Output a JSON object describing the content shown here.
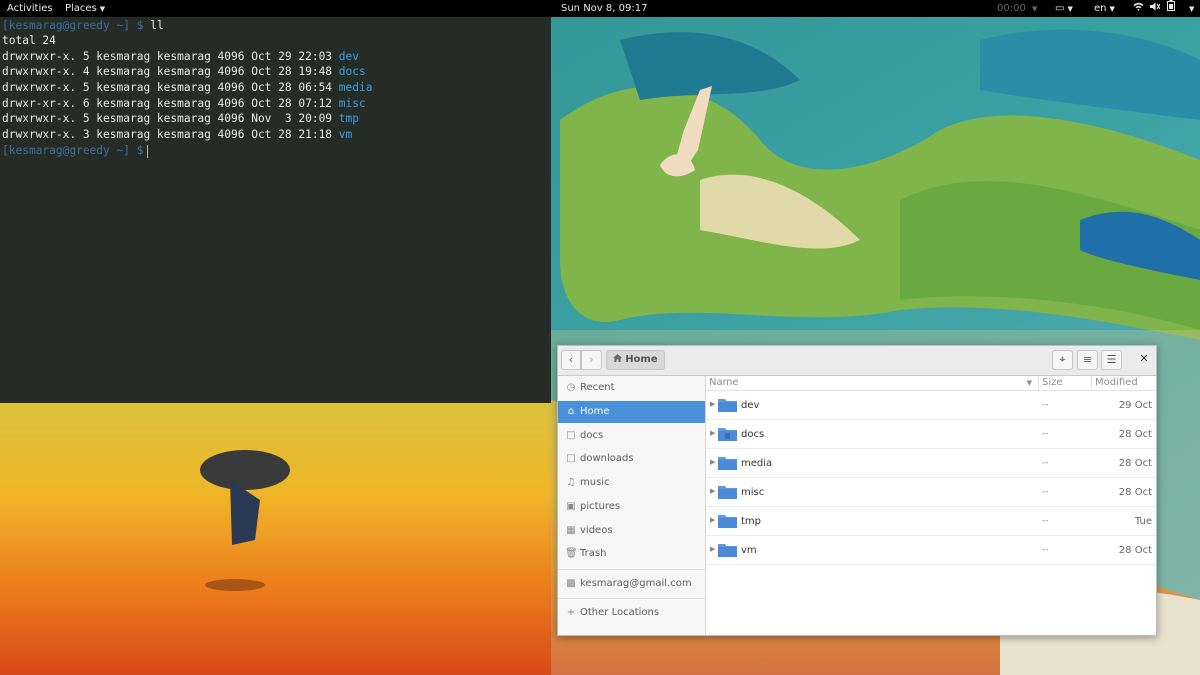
{
  "topbar": {
    "activities": "Activities",
    "places": "Places",
    "clock": "Sun Nov  8, 09:17",
    "media_time": "00:00",
    "language": "en"
  },
  "terminal": {
    "prompt": "[kesmarag@greedy ~] $",
    "command": "ll",
    "total": "total 24",
    "entries": [
      {
        "perm": "drwxrwxr-x. 5 kesmarag kesmarag 4096 Oct 29 22:03 ",
        "name": "dev"
      },
      {
        "perm": "drwxrwxr-x. 4 kesmarag kesmarag 4096 Oct 28 19:48 ",
        "name": "docs"
      },
      {
        "perm": "drwxrwxr-x. 5 kesmarag kesmarag 4096 Oct 28 06:54 ",
        "name": "media"
      },
      {
        "perm": "drwxr-xr-x. 6 kesmarag kesmarag 4096 Oct 28 07:12 ",
        "name": "misc"
      },
      {
        "perm": "drwxrwxr-x. 5 kesmarag kesmarag 4096 Nov  3 20:09 ",
        "name": "tmp"
      },
      {
        "perm": "drwxrwxr-x. 3 kesmarag kesmarag 4096 Oct 28 21:18 ",
        "name": "vm"
      }
    ]
  },
  "files": {
    "location": "Home",
    "sidebar": [
      {
        "label": "Recent",
        "icon": "clock-icon"
      },
      {
        "label": "Home",
        "icon": "home-icon"
      },
      {
        "label": "docs",
        "icon": "folder-icon"
      },
      {
        "label": "downloads",
        "icon": "folder-icon"
      },
      {
        "label": "music",
        "icon": "music-icon"
      },
      {
        "label": "pictures",
        "icon": "picture-icon"
      },
      {
        "label": "videos",
        "icon": "video-icon"
      },
      {
        "label": "Trash",
        "icon": "trash-icon"
      },
      {
        "label": "kesmarag@gmail.com",
        "icon": "account-icon"
      },
      {
        "label": "Other Locations",
        "icon": "plus-icon"
      }
    ],
    "columns": {
      "name": "Name",
      "size": "Size",
      "modified": "Modified"
    },
    "rows": [
      {
        "name": "dev",
        "size": "--",
        "modified": "29 Oct"
      },
      {
        "name": "docs",
        "size": "--",
        "modified": "28 Oct"
      },
      {
        "name": "media",
        "size": "--",
        "modified": "28 Oct"
      },
      {
        "name": "misc",
        "size": "--",
        "modified": "28 Oct"
      },
      {
        "name": "tmp",
        "size": "--",
        "modified": "Tue"
      },
      {
        "name": "vm",
        "size": "--",
        "modified": "28 Oct"
      }
    ]
  },
  "colors": {
    "accent": "#4a90d9",
    "terminal_dir": "#3c9fe8",
    "folder": "#5a9be0"
  }
}
